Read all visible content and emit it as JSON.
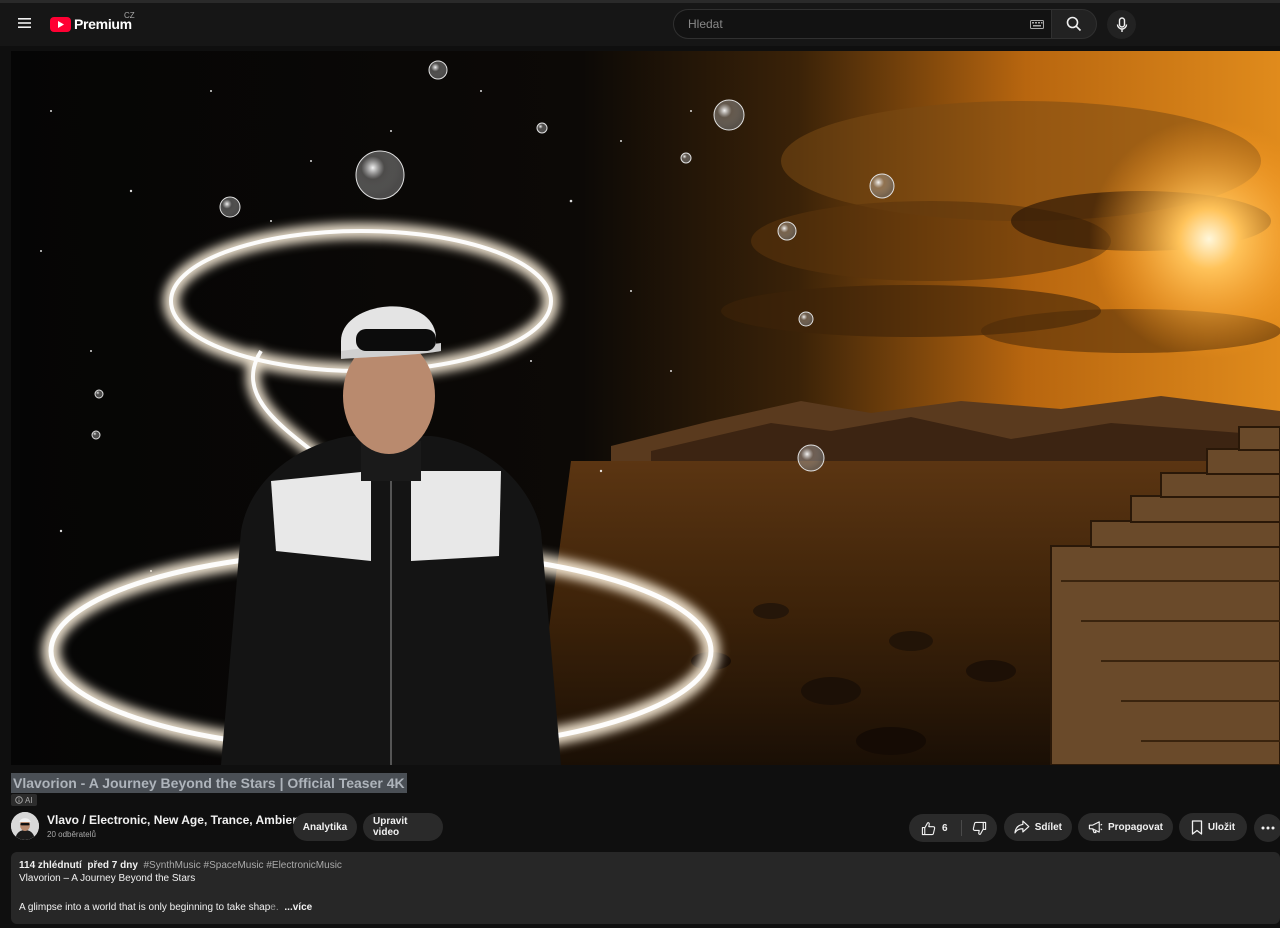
{
  "masthead": {
    "logo_text": "Premium",
    "country": "CZ",
    "search_placeholder": "Hledat"
  },
  "video": {
    "title": "Vlavorion - A Journey Beyond the Stars | Official Teaser 4K",
    "ai_label": "AI"
  },
  "channel": {
    "name": "Vlavo / Electronic, New Age, Trance, Ambient.",
    "subscribers": "20 odběratelů"
  },
  "actions": {
    "analytics": "Analytika",
    "edit": "Upravit video",
    "like_count": "6",
    "share": "Sdílet",
    "promote": "Propagovat",
    "save": "Uložit"
  },
  "description": {
    "views": "114 zhlédnutí",
    "date": "před 7 dny",
    "tags": "#SynthMusic #SpaceMusic #ElectronicMusic",
    "line1": "Vlavorion – A Journey Beyond the Stars",
    "line2_main": "A glimpse into a world that is only beginning to take shap",
    "line2_fade": "e.",
    "more": "...více"
  },
  "colors": {
    "background": "#0f0f0f",
    "youtube_red": "#ff0033",
    "pill": "#2a2a2a",
    "description_bg": "#272727"
  }
}
